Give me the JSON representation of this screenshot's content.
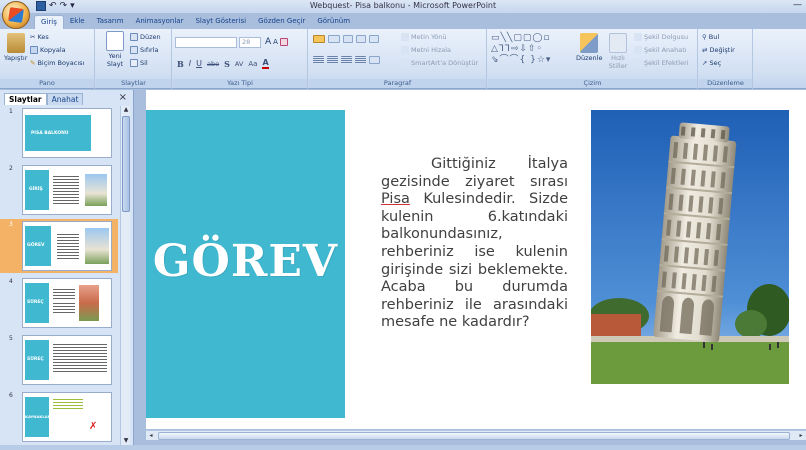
{
  "window": {
    "title": "Webquest- Pisa balkonu - Microsoft PowerPoint",
    "controls": "—"
  },
  "ribbon_tabs": [
    "Giriş",
    "Ekle",
    "Tasarım",
    "Animasyonlar",
    "Slayt Gösterisi",
    "Gözden Geçir",
    "Görünüm"
  ],
  "active_tab": "Giriş",
  "ribbon": {
    "pano": {
      "label": "Pano",
      "paste": "Yapıştır",
      "cut": "Kes",
      "copy": "Kopyala",
      "format_painter": "Biçim Boyacısı"
    },
    "slaytlar": {
      "label": "Slaytlar",
      "new_slide": "Yeni Slayt",
      "layout": "Düzen",
      "reset": "Sıfırla",
      "delete": "Sil"
    },
    "yazi_tipi": {
      "label": "Yazı Tipi",
      "font_size": "28",
      "bold": "B",
      "italic": "I",
      "underline": "U",
      "strike": "abe",
      "shadow": "S",
      "spacing": "AV",
      "case": "Aa",
      "grow": "A",
      "shrink": "A"
    },
    "paragraf": {
      "label": "Paragraf",
      "text_direction": "Metin Yönü",
      "align_text": "Metni Hizala",
      "smartart": "SmartArt'a Dönüştür"
    },
    "cizim": {
      "label": "Çizim",
      "arrange": "Düzenle",
      "quick_styles": "Hızlı Stiller",
      "shape_fill": "Şekil Dolgusu",
      "shape_outline": "Şekil Anahatı",
      "shape_effects": "Şekil Efektleri"
    },
    "duzenleme": {
      "label": "Düzenleme",
      "find": "Bul",
      "replace": "Değiştir",
      "select": "Seç"
    }
  },
  "panel": {
    "tabs": [
      "Slaytlar",
      "Anahat"
    ],
    "active": "Slaytlar",
    "close": "×",
    "thumbnails": [
      {
        "num": "1",
        "label": "PISA BALKONU"
      },
      {
        "num": "2",
        "label": "GİRİŞ"
      },
      {
        "num": "3",
        "label": "GÖREV"
      },
      {
        "num": "4",
        "label": "SÜREÇ"
      },
      {
        "num": "5",
        "label": "SÜREÇ"
      },
      {
        "num": "6",
        "label": "KAYNAKLAR"
      }
    ],
    "selected_index": 2
  },
  "slide": {
    "title": "GÖREV",
    "body_before": "Gittiğiniz İtalya gezisinde ziyaret sırası ",
    "body_underlined": "Pisa",
    "body_after": " Kulesindedir. Sizde kulenin 6.katındaki balkonundasınız, rehberiniz ise kulenin girişinde sizi beklemekte. Acaba bu durumda rehberiniz ile arasındaki mesafe ne kadardır?",
    "colors": {
      "teal": "#40b8d0",
      "text": "#404040"
    }
  }
}
